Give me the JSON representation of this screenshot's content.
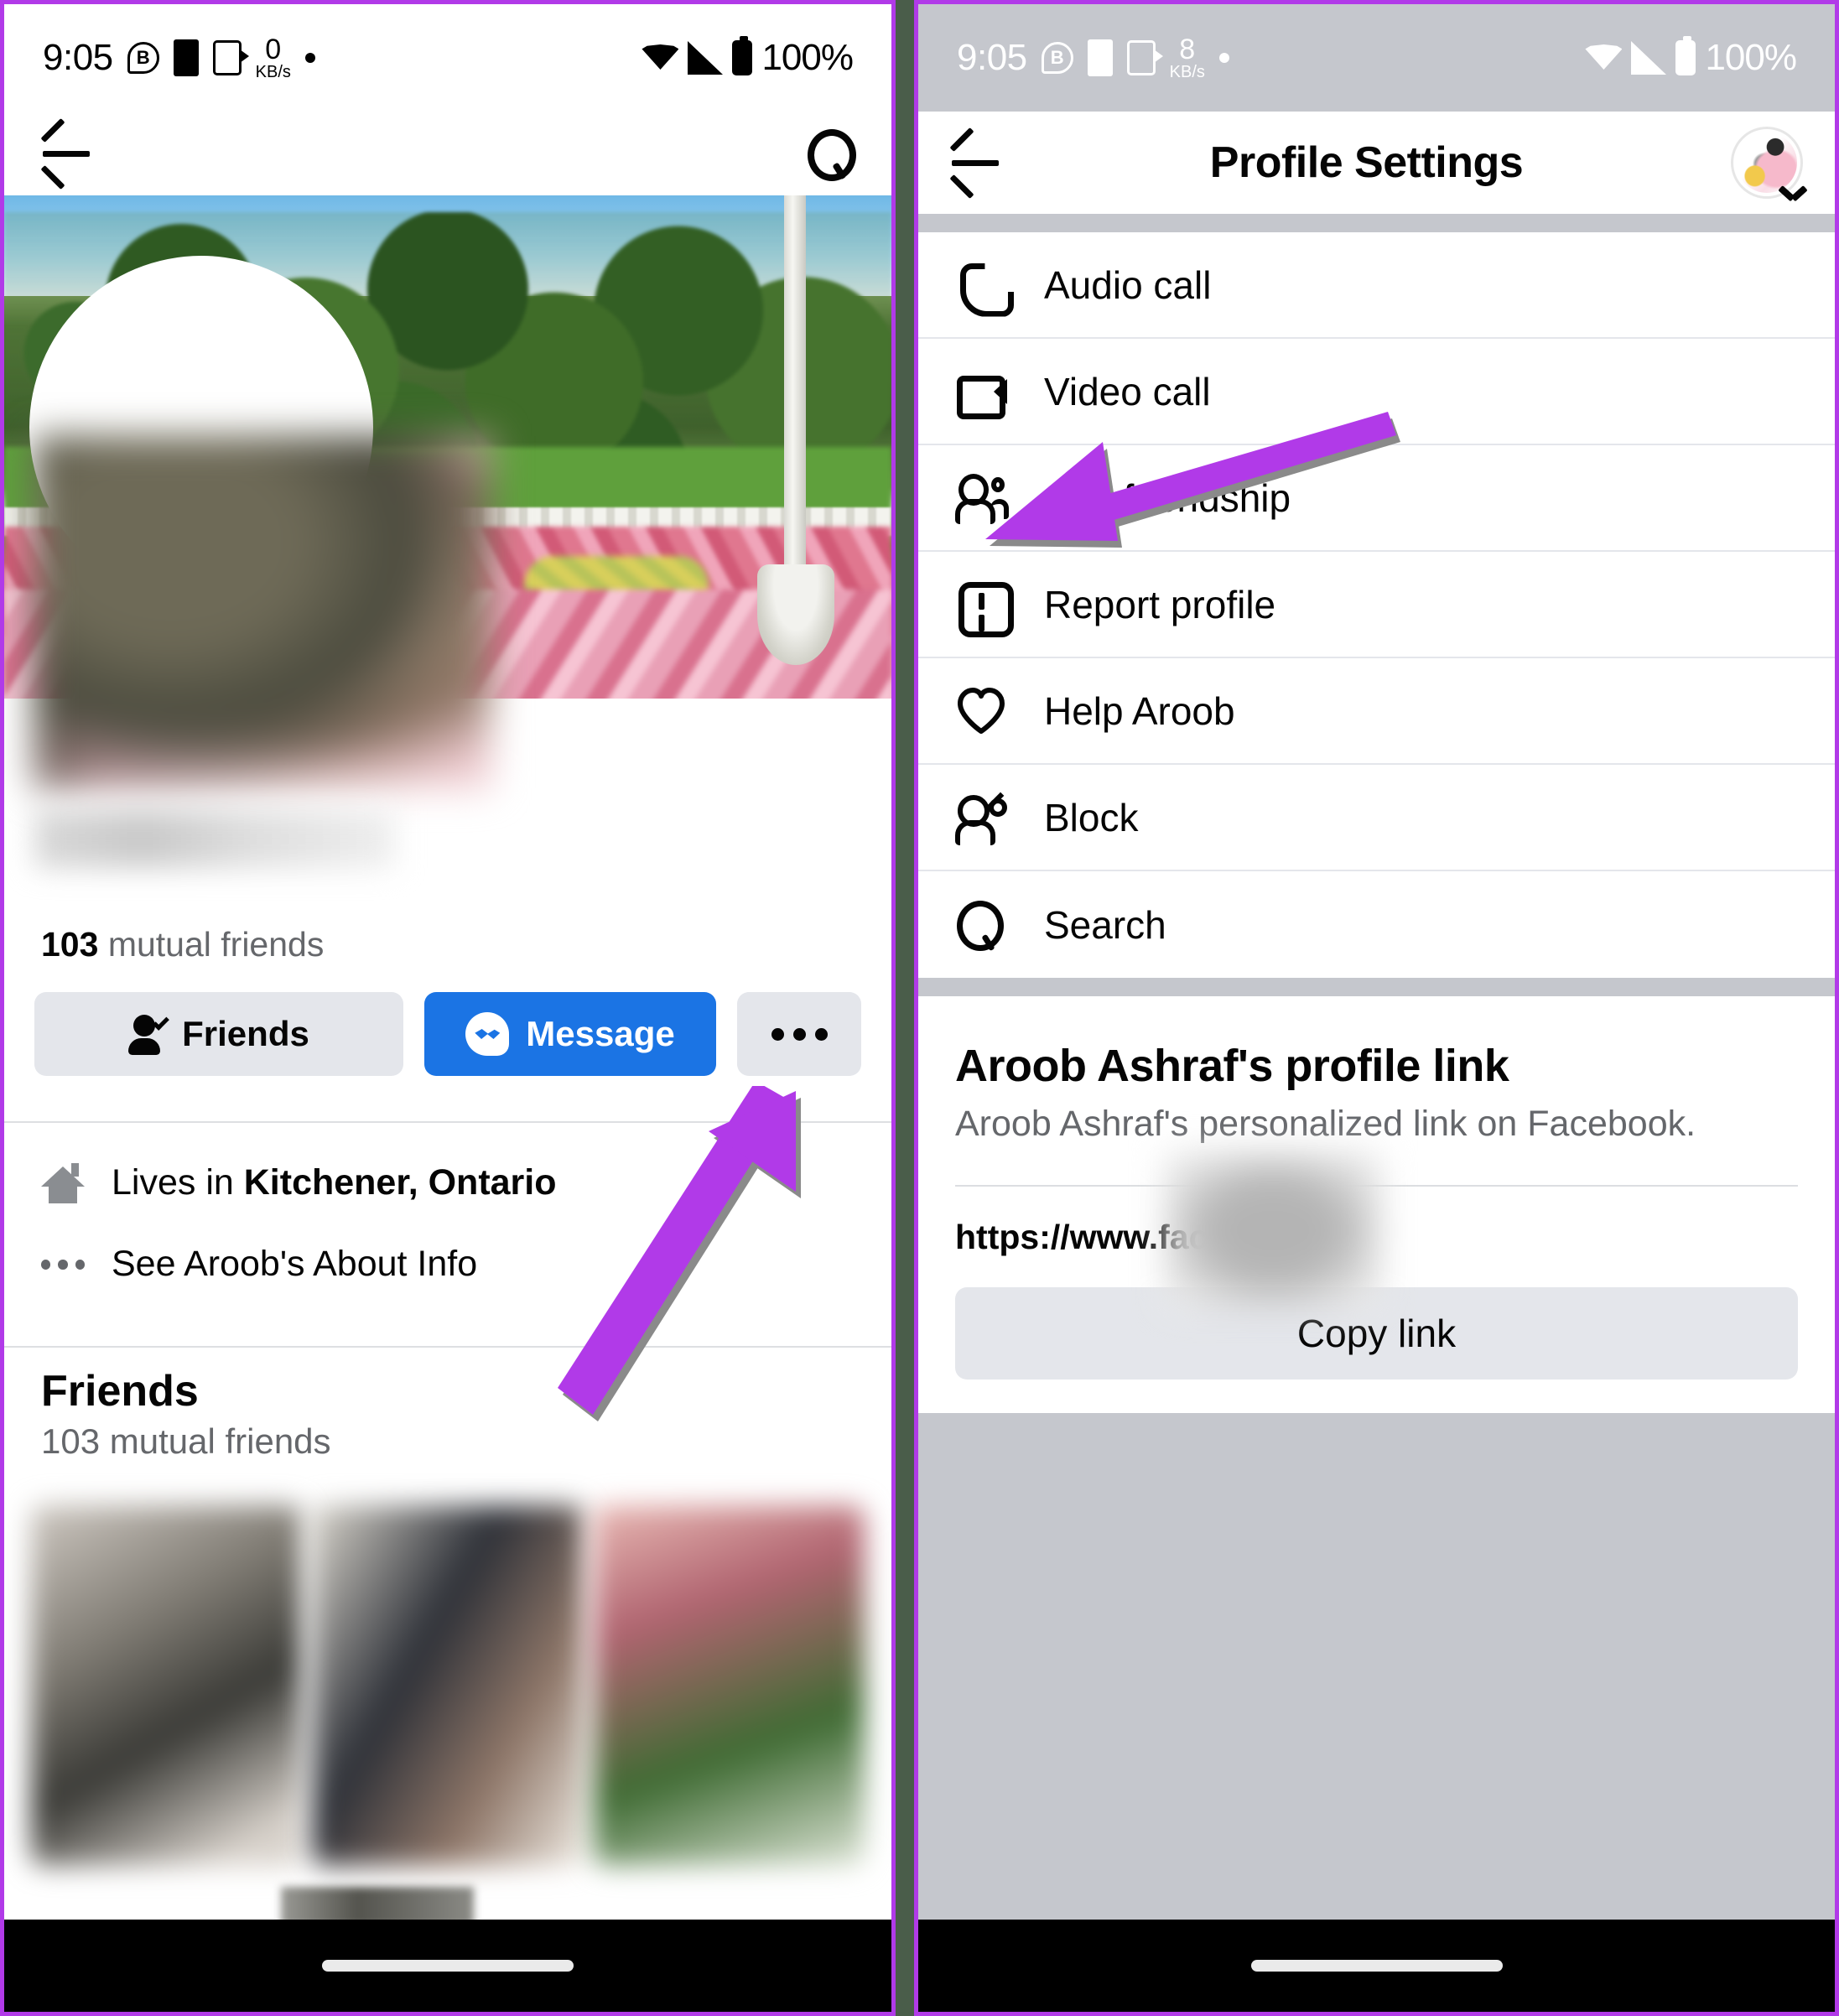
{
  "left_panel": {
    "status_bar": {
      "time": "9:05",
      "bluetooth_badge": "B",
      "network_speed_value": "0",
      "network_speed_unit": "KB/s",
      "battery_percent": "100%",
      "icons": [
        "bluetooth-badge-icon",
        "dnd-icon",
        "cast-icon",
        "data-speed-icon",
        "dot-icon",
        "wifi-icon",
        "signal-icon",
        "battery-icon"
      ]
    },
    "app_bar": {
      "back_icon": "back-arrow-icon",
      "search_icon": "search-icon"
    },
    "profile": {
      "name_redacted": "",
      "mutual_count": "103",
      "mutual_label": "mutual friends",
      "buttons": {
        "friends": "Friends",
        "message": "Message",
        "more": "•••"
      }
    },
    "info": {
      "lives_in_prefix": "Lives in ",
      "lives_in_place": "Kitchener, Ontario",
      "about_info": "See Aroob's About Info"
    },
    "friends_section": {
      "title": "Friends",
      "subtitle": "103 mutual friends"
    }
  },
  "right_panel": {
    "status_bar": {
      "time": "9:05",
      "bluetooth_badge": "B",
      "network_speed_value": "8",
      "network_speed_unit": "KB/s",
      "battery_percent": "100%"
    },
    "app_bar": {
      "back_icon": "back-arrow-icon",
      "title": "Profile Settings",
      "avatar_icon": "account-avatar-icon",
      "chevron_icon": "chevron-down-icon"
    },
    "menu": [
      {
        "label": "Audio call",
        "icon": "phone-icon"
      },
      {
        "label": "Video call",
        "icon": "video-camera-icon"
      },
      {
        "label": "See friendship",
        "icon": "two-people-icon"
      },
      {
        "label": "Report profile",
        "icon": "exclamation-square-icon"
      },
      {
        "label": "Help Aroob",
        "icon": "heart-icon"
      },
      {
        "label": "Block",
        "icon": "block-user-icon"
      },
      {
        "label": "Search",
        "icon": "search-icon"
      }
    ],
    "profile_link": {
      "title": "Aroob Ashraf's profile link",
      "subtitle": "Aroob Ashraf's personalized link on Facebook.",
      "url_visible": "https://www.facebook",
      "copy_button": "Copy link"
    }
  },
  "annotations": {
    "arrow_color": "#b13ae8",
    "arrows": [
      {
        "name": "arrow-to-more-button",
        "points_to": "more-button"
      },
      {
        "name": "arrow-to-block-item",
        "points_to": "Block"
      }
    ]
  },
  "colors": {
    "accent_purple": "#b13ae8",
    "facebook_blue": "#1b74e4",
    "button_grey": "#e4e6eb",
    "text_primary": "#050505",
    "text_secondary": "#65676b",
    "statusbar_grey": "#c5c7cd"
  }
}
